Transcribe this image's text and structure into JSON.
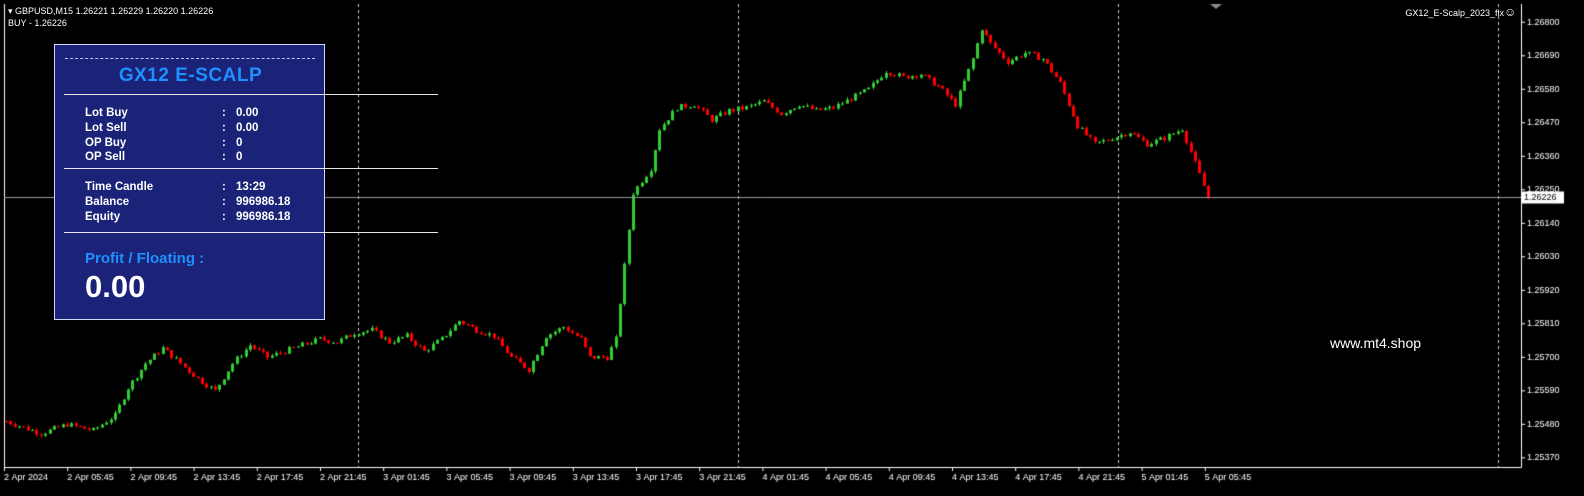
{
  "header": {
    "symbol_line": "GBPUSD,M15  1.26221 1.26229 1.26220 1.26226",
    "order_line": "BUY - 1.26226"
  },
  "ea_label": "GX12_E-Scalp_2023_fix",
  "smiley_icon": "smiley-icon",
  "watermark": "www.mt4.shop",
  "panel": {
    "title": "GX12 E-SCALP",
    "rows": [
      {
        "key": "Lot Buy",
        "colon": ":",
        "value": "0.00"
      },
      {
        "key": "Lot Sell",
        "colon": ":",
        "value": "0.00"
      },
      {
        "key": "OP Buy",
        "colon": ":",
        "value": "0"
      },
      {
        "key": "OP Sell",
        "colon": ":",
        "value": "0"
      },
      {
        "key": "Time Candle",
        "colon": ":",
        "value": "13:29"
      },
      {
        "key": "Balance",
        "colon": ":",
        "value": "996986.18"
      },
      {
        "key": "Equity",
        "colon": ":",
        "value": "996986.18"
      }
    ],
    "profit_label": "Profit / Floating  :",
    "profit_value": "0.00"
  },
  "colors": {
    "background": "#000000",
    "bull": "#32cd32",
    "bear": "#ff0000",
    "panel_bg": "#1a2377",
    "panel_accent": "#1e90ff"
  },
  "chart_data": {
    "type": "candlestick",
    "current_price": "1.26226",
    "y_ticks": [
      "1.26800",
      "1.26690",
      "1.26580",
      "1.26470",
      "1.26360",
      "1.26250",
      "1.26140",
      "1.26030",
      "1.25920",
      "1.25810",
      "1.25700",
      "1.25590",
      "1.25480",
      "1.25370"
    ],
    "x_ticks": [
      "2 Apr 2024",
      "2 Apr 05:45",
      "2 Apr 09:45",
      "2 Apr 13:45",
      "2 Apr 17:45",
      "2 Apr 21:45",
      "3 Apr 01:45",
      "3 Apr 05:45",
      "3 Apr 09:45",
      "3 Apr 13:45",
      "3 Apr 17:45",
      "3 Apr 21:45",
      "4 Apr 01:45",
      "4 Apr 05:45",
      "4 Apr 09:45",
      "4 Apr 13:45",
      "4 Apr 17:45",
      "4 Apr 21:45",
      "5 Apr 01:45",
      "5 Apr 05:45"
    ],
    "day_separators": [
      "3 Apr",
      "4 Apr",
      "5 Apr"
    ],
    "ylim": [
      1.2534,
      1.2686
    ],
    "close_path": [
      [
        0,
        1.2549
      ],
      [
        8,
        1.2545
      ],
      [
        14,
        1.2548
      ],
      [
        20,
        1.2546
      ],
      [
        25,
        1.2551
      ],
      [
        28,
        1.256
      ],
      [
        32,
        1.2568
      ],
      [
        36,
        1.2573
      ],
      [
        40,
        1.2568
      ],
      [
        44,
        1.2563
      ],
      [
        48,
        1.2559
      ],
      [
        52,
        1.2568
      ],
      [
        56,
        1.2574
      ],
      [
        60,
        1.257
      ],
      [
        66,
        1.2573
      ],
      [
        72,
        1.2576
      ],
      [
        76,
        1.2575
      ],
      [
        80,
        1.2578
      ],
      [
        84,
        1.2579
      ],
      [
        88,
        1.2575
      ],
      [
        92,
        1.2577
      ],
      [
        96,
        1.2572
      ],
      [
        100,
        1.2576
      ],
      [
        104,
        1.2582
      ],
      [
        108,
        1.2579
      ],
      [
        112,
        1.2577
      ],
      [
        116,
        1.257
      ],
      [
        120,
        1.2566
      ],
      [
        124,
        1.2577
      ],
      [
        128,
        1.258
      ],
      [
        132,
        1.2576
      ],
      [
        134,
        1.257
      ],
      [
        138,
        1.257
      ],
      [
        140,
        1.2576
      ],
      [
        142,
        1.26
      ],
      [
        144,
        1.2624
      ],
      [
        148,
        1.2632
      ],
      [
        150,
        1.2645
      ],
      [
        154,
        1.2652
      ],
      [
        158,
        1.2653
      ],
      [
        162,
        1.2648
      ],
      [
        166,
        1.2651
      ],
      [
        170,
        1.2652
      ],
      [
        174,
        1.2654
      ],
      [
        178,
        1.265
      ],
      [
        182,
        1.2653
      ],
      [
        186,
        1.2651
      ],
      [
        190,
        1.2652
      ],
      [
        194,
        1.2655
      ],
      [
        198,
        1.2658
      ],
      [
        202,
        1.2664
      ],
      [
        206,
        1.2662
      ],
      [
        210,
        1.2663
      ],
      [
        214,
        1.2659
      ],
      [
        218,
        1.2653
      ],
      [
        222,
        1.2668
      ],
      [
        224,
        1.2678
      ],
      [
        226,
        1.2673
      ],
      [
        230,
        1.2667
      ],
      [
        234,
        1.267
      ],
      [
        238,
        1.2668
      ],
      [
        242,
        1.266
      ],
      [
        246,
        1.2646
      ],
      [
        250,
        1.264
      ],
      [
        254,
        1.2642
      ],
      [
        258,
        1.2644
      ],
      [
        262,
        1.264
      ],
      [
        266,
        1.2642
      ],
      [
        270,
        1.2645
      ],
      [
        274,
        1.263
      ],
      [
        276,
        1.26226
      ]
    ]
  }
}
